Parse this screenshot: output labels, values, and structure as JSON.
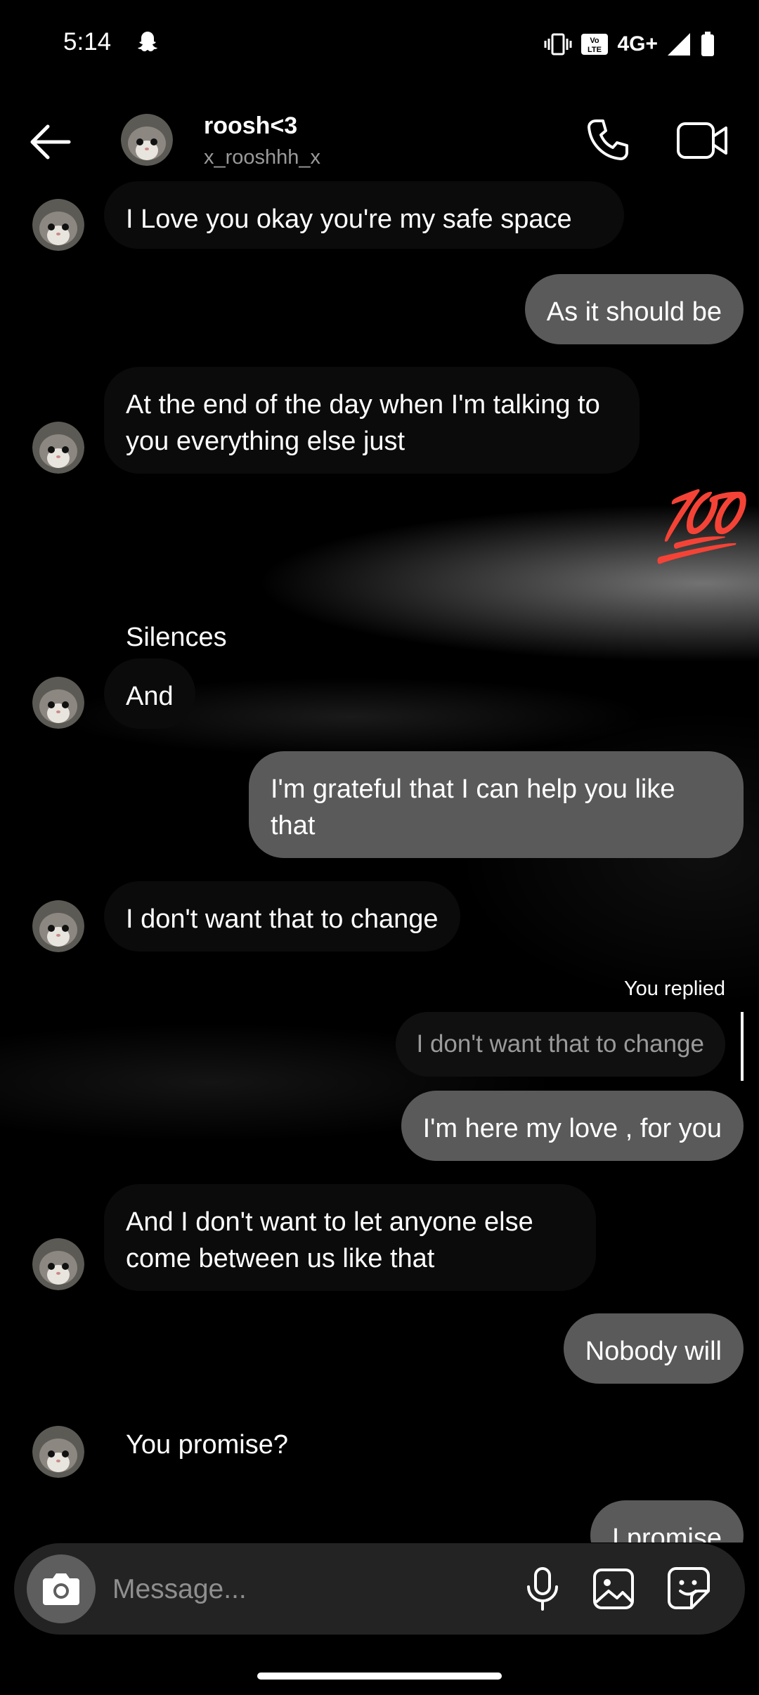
{
  "status_bar": {
    "time": "5:14",
    "network": "4G+"
  },
  "header": {
    "name": "roosh<3",
    "username": "x_rooshhh_x",
    "icons": [
      "back-arrow-icon",
      "cat-avatar",
      "phone-icon",
      "video-icon"
    ]
  },
  "messages": [
    {
      "side": "in",
      "text": "I Love you okay you're my safe space"
    },
    {
      "side": "out",
      "text": "As it should be"
    },
    {
      "side": "in",
      "text": "At the end of the day when I'm talking to you everything else just"
    },
    {
      "side": "out",
      "text": "💯"
    },
    {
      "side": "in",
      "text": "Silences"
    },
    {
      "side": "in",
      "text": "And"
    },
    {
      "side": "out",
      "text": "I'm grateful that I can help you like that"
    },
    {
      "side": "in",
      "text": "I don't want that to change"
    },
    {
      "side": "out",
      "text": "I'm here my love , for you"
    },
    {
      "side": "in",
      "text": "And I don't want to let anyone else come between us like that"
    },
    {
      "side": "out",
      "text": "Nobody will"
    },
    {
      "side": "in",
      "text": "You promise?"
    },
    {
      "side": "out",
      "text": "I promise"
    }
  ],
  "reply": {
    "label": "You replied",
    "quoted": "I don't want that to change"
  },
  "composer": {
    "placeholder": "Message..."
  },
  "colors": {
    "outgoing_bubble": "#5a5a5a",
    "incoming_bubble": "#0b0b0b",
    "background": "#000000"
  }
}
